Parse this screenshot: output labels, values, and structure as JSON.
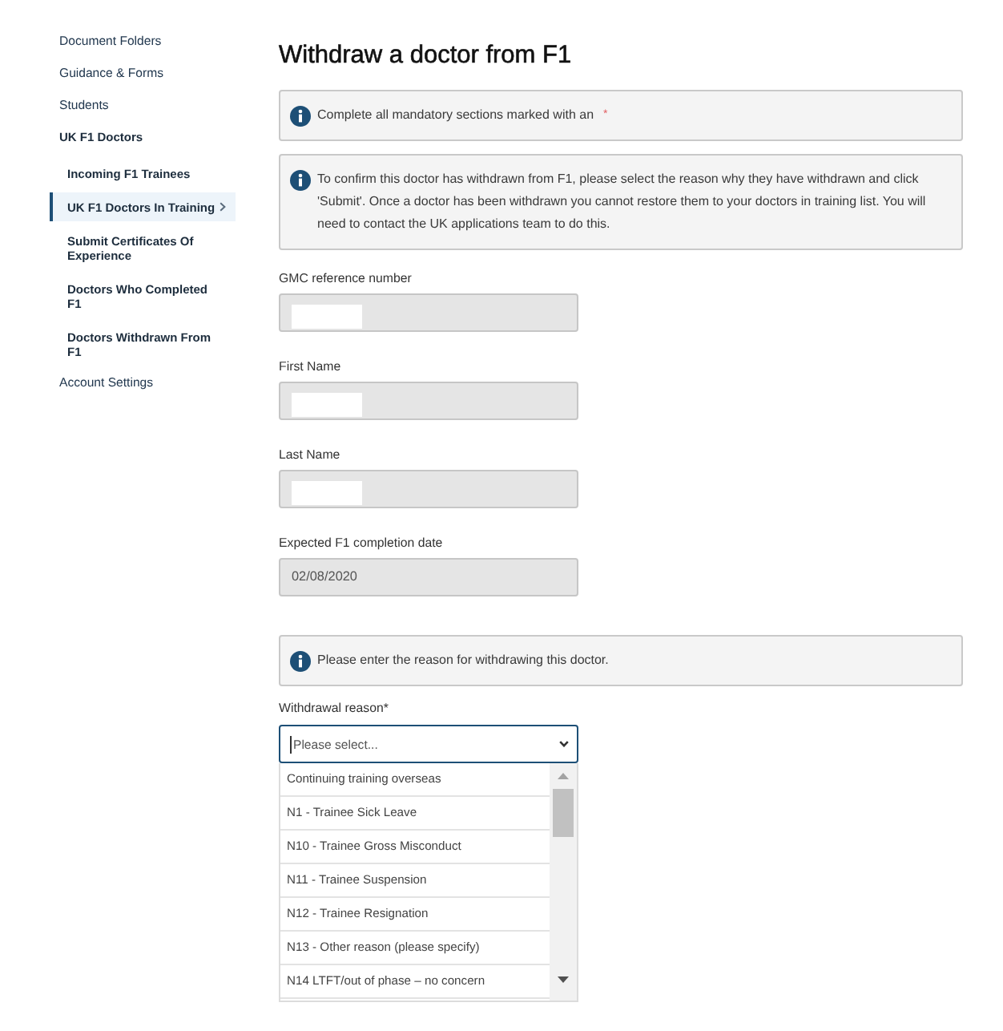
{
  "sidebar": {
    "items": [
      {
        "label": "Document Folders",
        "selected": false
      },
      {
        "label": "Guidance & Forms",
        "selected": false
      },
      {
        "label": "Students",
        "selected": false
      },
      {
        "label": "UK F1 Doctors",
        "selected": false,
        "children": [
          {
            "label": "Incoming F1 Trainees",
            "selected": false
          },
          {
            "label": "UK F1 Doctors In Training",
            "selected": true
          },
          {
            "label": "Submit Certificates Of Experience",
            "selected": false
          },
          {
            "label": "Doctors Who Completed F1",
            "selected": false
          },
          {
            "label": "Doctors Withdrawn From F1",
            "selected": false
          }
        ]
      },
      {
        "label": "Account Settings",
        "selected": false
      }
    ]
  },
  "page": {
    "title": "Withdraw a doctor from F1"
  },
  "content": [
    {
      "kind": "notice",
      "text": "Complete all mandatory sections marked with an",
      "required_mark": "*"
    },
    {
      "kind": "notice",
      "text": "To confirm this doctor has withdrawn from F1, please select the reason why they have withdrawn and click 'Submit'. Once a doctor has been withdrawn you cannot restore them to your doctors in training list. You will need to contact the UK applications team to do this."
    },
    {
      "kind": "field",
      "label": "GMC reference number",
      "disabled": true,
      "redacted": true
    },
    {
      "kind": "field",
      "label": "First Name",
      "disabled": true,
      "redacted": true
    },
    {
      "kind": "field",
      "label": "Last Name",
      "disabled": true,
      "redacted": true
    },
    {
      "kind": "field",
      "label": "Expected F1 completion date",
      "value": "02/08/2020",
      "disabled": true
    },
    {
      "kind": "notice",
      "text": "Please enter the reason for withdrawing this doctor."
    },
    {
      "kind": "select",
      "label": "Withdrawal reason*",
      "placeholder": "Please select...",
      "focused": true,
      "expanded": true,
      "options": [
        {
          "label": "Continuing training overseas",
          "selected": false
        },
        {
          "label": "N1 - Trainee Sick Leave",
          "selected": false
        },
        {
          "label": "N10 - Trainee Gross Misconduct",
          "selected": false
        },
        {
          "label": "N11 - Trainee Suspension",
          "selected": false
        },
        {
          "label": "N12 - Trainee Resignation",
          "selected": false
        },
        {
          "label": "N13 - Other reason (please specify)",
          "selected": false
        },
        {
          "label": "N14 LTFT/out of phase – no concern",
          "selected": false
        }
      ]
    }
  ]
}
